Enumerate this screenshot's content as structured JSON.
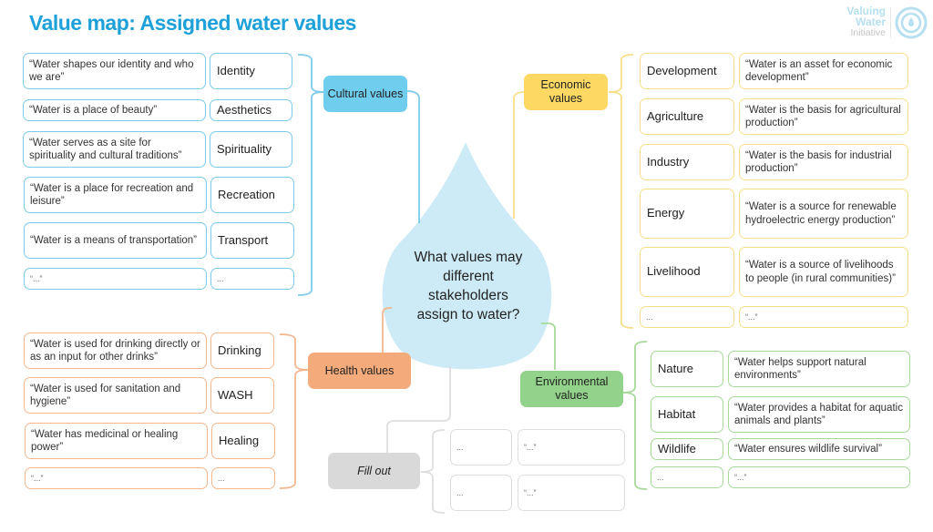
{
  "title": "Value map: Assigned water values",
  "logo": {
    "line1": "Valuing",
    "line2": "Water",
    "line3": "Initiative"
  },
  "center_question": "What values may different stakeholders assign to water?",
  "colors": {
    "cultural": "#6fcdee",
    "economic": "#fdd964",
    "health": "#f4ab7c",
    "environmental": "#92d28a",
    "fill_out": "#d9d9d9",
    "drop": "#cdebf6",
    "title": "#1ea1d9"
  },
  "cultural": {
    "hub": "Cultural values",
    "items": [
      {
        "label": "Identity",
        "quote": "“Water shapes our identity and who we are”"
      },
      {
        "label": "Aesthetics",
        "quote": "“Water is a place of beauty”"
      },
      {
        "label": "Spirituality",
        "quote": "“Water serves as a site for spirituality and cultural traditions”"
      },
      {
        "label": "Recreation",
        "quote": "“Water is a place for recreation and leisure”"
      },
      {
        "label": "Transport",
        "quote": "“Water is a means of transportation”"
      },
      {
        "label": "...",
        "quote": "“...”"
      }
    ]
  },
  "economic": {
    "hub": "Economic values",
    "items": [
      {
        "label": "Development",
        "quote": "“Water is an asset for economic development”"
      },
      {
        "label": "Agriculture",
        "quote": "“Water is the basis for agricultural production”"
      },
      {
        "label": "Industry",
        "quote": "“Water is the basis for industrial production”"
      },
      {
        "label": "Energy",
        "quote": "“Water is a source for renewable hydroelectric energy production”"
      },
      {
        "label": "Livelihood",
        "quote": "“Water is a source of livelihoods to people (in rural communities)”"
      },
      {
        "label": "...",
        "quote": "“...”"
      }
    ]
  },
  "health": {
    "hub": "Health values",
    "items": [
      {
        "label": "Drinking",
        "quote": "“Water is used for drinking directly or as an input for other drinks”"
      },
      {
        "label": "WASH",
        "quote": "“Water is used for sanitation and hygiene”"
      },
      {
        "label": "Healing",
        "quote": "“Water has medicinal or healing power”"
      },
      {
        "label": "...",
        "quote": "“...”"
      }
    ]
  },
  "environmental": {
    "hub": "Environmental values",
    "items": [
      {
        "label": "Nature",
        "quote": "“Water helps support natural environments”"
      },
      {
        "label": "Habitat",
        "quote": "“Water provides a habitat for aquatic animals and plants”"
      },
      {
        "label": "Wildlife",
        "quote": "“Water ensures wildlife survival”"
      },
      {
        "label": "...",
        "quote": "“...”"
      }
    ]
  },
  "fill_out": {
    "hub": "Fill out",
    "items": [
      {
        "label": "...",
        "quote": "“...”"
      },
      {
        "label": "...",
        "quote": "“...”"
      }
    ]
  }
}
